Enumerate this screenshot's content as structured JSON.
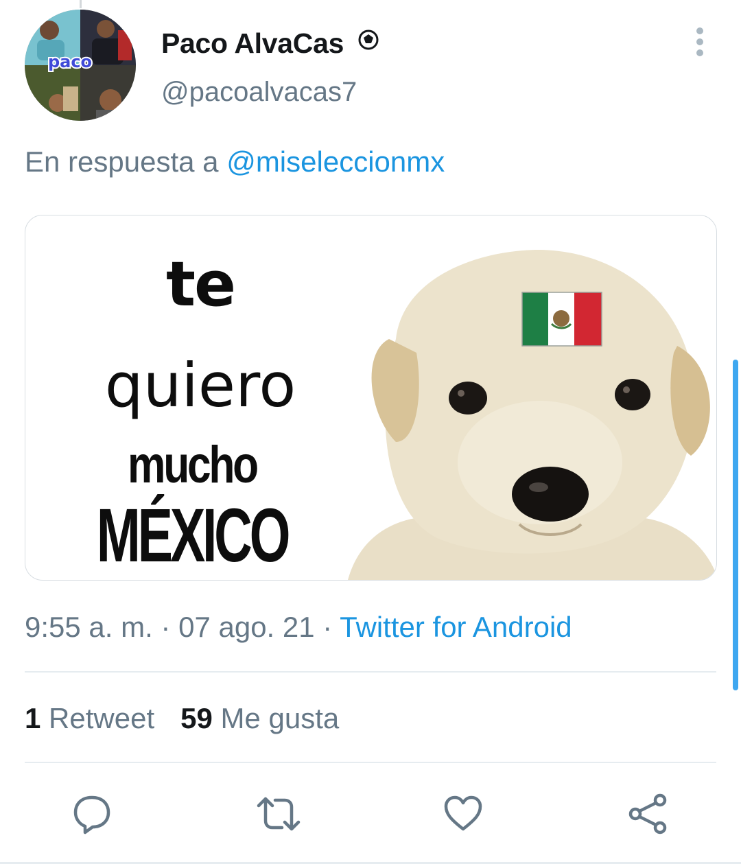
{
  "tweet": {
    "author_name": "Paco AlvaCas",
    "author_handle": "@pacoalvacas7",
    "avatar_label": "paco",
    "reply_prefix": "En respuesta a",
    "reply_to": "@miseleccionmx",
    "media": {
      "line1": "te",
      "line2": "quiero",
      "line3": "mucho",
      "line4": "MÉXICO",
      "flag_colors": [
        "#1e7f45",
        "#ffffff",
        "#d22732"
      ]
    },
    "timestamp": "9:55 a. m. · 07 ago. 21 · ",
    "source": "Twitter for Android",
    "retweets_count": "1",
    "retweets_label": "Retweet",
    "likes_count": "59",
    "likes_label": "Me gusta"
  },
  "actions": {
    "reply_icon": "reply-icon",
    "retweet_icon": "retweet-icon",
    "like_icon": "like-icon",
    "share_icon": "share-icon",
    "icon_color": "#657786"
  },
  "colors": {
    "link": "#1b95e0",
    "secondary_text": "#657786",
    "primary_text": "#14171a",
    "scrollbar": "#3ea7f0"
  }
}
